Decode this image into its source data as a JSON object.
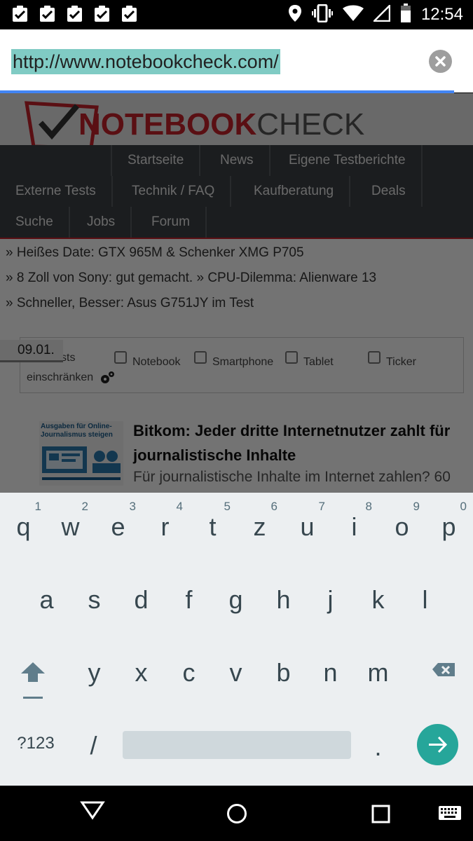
{
  "status_bar": {
    "time": "12:54",
    "notification_icons": [
      "clipboard-check-icon",
      "clipboard-check-icon",
      "clipboard-check-icon",
      "clipboard-check-icon",
      "clipboard-check-icon"
    ],
    "system_icons": [
      "location-icon",
      "vibrate-icon",
      "wifi-icon",
      "signal-icon",
      "battery-icon"
    ]
  },
  "url_bar": {
    "url": "http://www.notebookcheck.com/",
    "highlight_color": "#80cbc4",
    "progress_color": "#4285f4"
  },
  "page": {
    "logo": {
      "part1": "NOTEBOOK",
      "part2": "CHECK"
    },
    "nav_row1": [
      "Startseite",
      "News",
      "Eigene Testberichte"
    ],
    "nav_row2": [
      "Externe Tests",
      "Technik / FAQ",
      "Kaufberatung",
      "Deals"
    ],
    "nav_row3": [
      "Suche",
      "Jobs",
      "Forum"
    ],
    "news_lines": [
      "» Heißes Date: GTX 965M & Schenker XMG P705",
      "» 8 Zoll von Sony: gut gemacht.    » CPU-Dilemma: Alienware 13",
      "» Schneller, Besser: Asus G751JY im Test"
    ],
    "date_tag": "09.01.",
    "filter": {
      "partial_label": "sts",
      "options": [
        "Notebook",
        "Smartphone",
        "Tablet",
        "Ticker"
      ],
      "restrict_label": "einschränken"
    },
    "article": {
      "thumb_caption": "Ausgaben für Online-Journalismus steigen",
      "title": "Bitkom: Jeder dritte Internetnutzer zahlt für journalistische Inhalte",
      "teaser": "Für journalistische Inhalte im Internet zahlen? 60"
    }
  },
  "keyboard": {
    "row1": [
      {
        "letter": "q",
        "hint": "1"
      },
      {
        "letter": "w",
        "hint": "2"
      },
      {
        "letter": "e",
        "hint": "3"
      },
      {
        "letter": "r",
        "hint": "4"
      },
      {
        "letter": "t",
        "hint": "5"
      },
      {
        "letter": "z",
        "hint": "6"
      },
      {
        "letter": "u",
        "hint": "7"
      },
      {
        "letter": "i",
        "hint": "8"
      },
      {
        "letter": "o",
        "hint": "9"
      },
      {
        "letter": "p",
        "hint": "0"
      }
    ],
    "row2": [
      "a",
      "s",
      "d",
      "f",
      "g",
      "h",
      "j",
      "k",
      "l"
    ],
    "row3": [
      "y",
      "x",
      "c",
      "v",
      "b",
      "n",
      "m"
    ],
    "symbols_label": "?123",
    "slash_label": "/",
    "period_label": ".",
    "accent_color": "#26a69a"
  },
  "nav_bar": {
    "buttons": [
      "back-icon",
      "home-icon",
      "recents-icon",
      "keyboard-icon"
    ]
  }
}
